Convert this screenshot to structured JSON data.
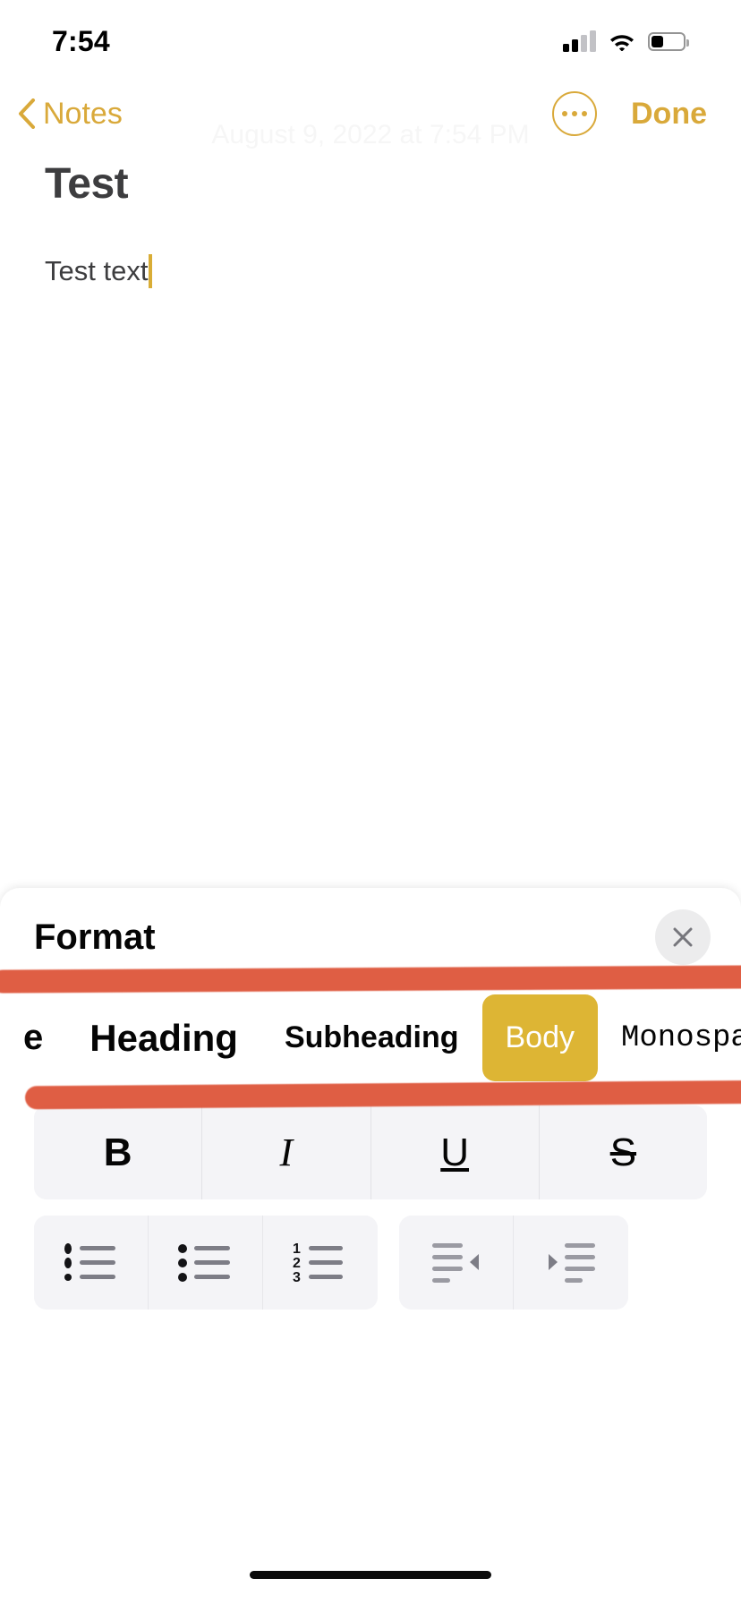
{
  "status_bar": {
    "time": "7:54",
    "signal_icon": "cellular-signal-icon",
    "wifi_icon": "wifi-icon",
    "battery_icon": "battery-icon",
    "battery_level_pct": 38
  },
  "nav_bar": {
    "back_label": "Notes",
    "back_icon": "chevron-left-icon",
    "more_icon": "ellipsis-circle-icon",
    "done_label": "Done",
    "accent_color": "#d9a93a"
  },
  "note": {
    "date": "August 9, 2022 at 7:54 PM",
    "title": "Test",
    "body": "Test text",
    "caret_color": "#d9ad36",
    "title_color": "#3d3d3f"
  },
  "format_sheet": {
    "title": "Format",
    "close_icon": "close-icon",
    "styles": [
      {
        "label": "e",
        "class": "st-title",
        "selected": false,
        "name": "style-title"
      },
      {
        "label": "Heading",
        "class": "st-heading",
        "selected": false,
        "name": "style-heading"
      },
      {
        "label": "Subheading",
        "class": "st-subheading",
        "selected": false,
        "name": "style-subheading"
      },
      {
        "label": "Body",
        "class": "st-body",
        "selected": true,
        "name": "style-body"
      },
      {
        "label": "Monospac",
        "class": "st-mono",
        "selected": false,
        "name": "style-monospaced"
      }
    ],
    "selected_style": "Body",
    "selected_style_color": "#ddb534",
    "text_style_buttons": [
      {
        "label": "B",
        "name": "bold-button",
        "class": "bius-b"
      },
      {
        "label": "I",
        "name": "italic-button",
        "class": "bius-i"
      },
      {
        "label": "U",
        "name": "underline-button",
        "class": "bius-u"
      },
      {
        "label": "S",
        "name": "strikethrough-button",
        "class": "bius-s"
      }
    ],
    "list_buttons": [
      {
        "name": "dashed-list-button",
        "icon": "dashed-list-icon"
      },
      {
        "name": "bulleted-list-button",
        "icon": "bulleted-list-icon"
      },
      {
        "name": "numbered-list-button",
        "icon": "numbered-list-icon"
      }
    ],
    "indent_buttons": [
      {
        "name": "outdent-button",
        "icon": "outdent-icon"
      },
      {
        "name": "indent-button",
        "icon": "indent-icon"
      }
    ],
    "numbered_list_digits": [
      "1",
      "2",
      "3"
    ]
  },
  "annotations": {
    "highlight_color": "#dd5135",
    "stroke_count": 2,
    "target": "Body"
  }
}
